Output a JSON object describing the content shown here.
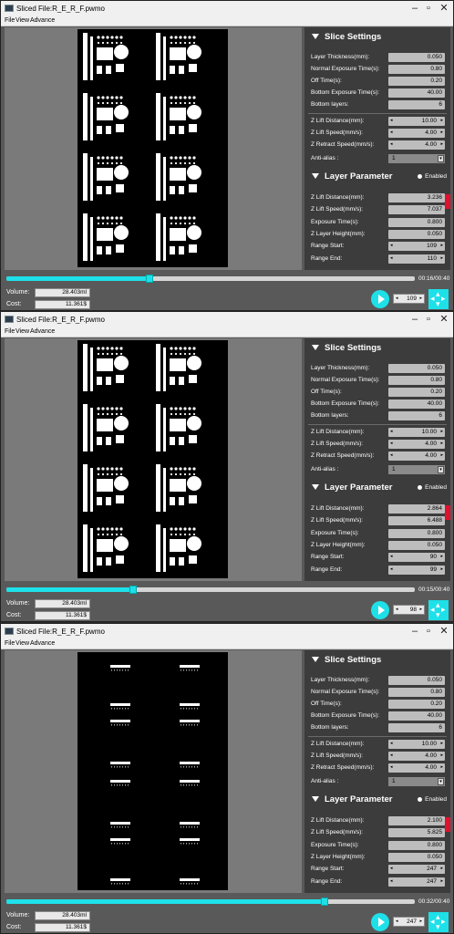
{
  "windows": [
    {
      "title": "Sliced File:R_E_R_F.pwmo",
      "menu": [
        "File",
        "View",
        "Advance"
      ],
      "slice_settings": {
        "header": "Slice Settings",
        "layer_thickness": {
          "label": "Layer Thickness(mm):",
          "value": "0.050"
        },
        "normal_exposure": {
          "label": "Normal Exposure Time(s):",
          "value": "0.80"
        },
        "off_time": {
          "label": "Off Time(s):",
          "value": "0.20"
        },
        "bottom_exposure": {
          "label": "Bottom Exposure Time(s):",
          "value": "40.00"
        },
        "bottom_layers": {
          "label": "Bottom layers:",
          "value": "6"
        },
        "z_lift_distance": {
          "label": "Z Lift Distance(mm):",
          "value": "10.00"
        },
        "z_lift_speed": {
          "label": "Z Lift Speed(mm/s):",
          "value": "4.00"
        },
        "z_retract_speed": {
          "label": "Z Retract Speed(mm/s):",
          "value": "4.00"
        },
        "anti_alias": {
          "label": "Anti-alias :",
          "value": "1"
        }
      },
      "layer_parameter": {
        "header": "Layer Parameter",
        "enabled_label": "Enabled",
        "z_lift_distance": {
          "label": "Z Lift Distance(mm):",
          "value": "3.236"
        },
        "z_lift_speed": {
          "label": "Z Lift Speed(mm/s):",
          "value": "7.037"
        },
        "exposure_time": {
          "label": "Exposure Time(s):",
          "value": "0.800"
        },
        "z_layer_height": {
          "label": "Z Layer Height(mm):",
          "value": "0.050"
        },
        "range_start": {
          "label": "Range Start:",
          "value": "109"
        },
        "range_end": {
          "label": "Range End:",
          "value": "110"
        }
      },
      "progress": 0.35,
      "time": "00:16/00:40",
      "volume": {
        "label": "Volume:",
        "value": "28.403ml"
      },
      "cost": {
        "label": "Cost:",
        "value": "11.361$"
      },
      "layer": "109",
      "preview_mode": "full"
    },
    {
      "title": "Sliced File:R_E_R_F.pwmo",
      "menu": [
        "File",
        "View",
        "Advance"
      ],
      "slice_settings": {
        "header": "Slice Settings",
        "layer_thickness": {
          "label": "Layer Thickness(mm):",
          "value": "0.050"
        },
        "normal_exposure": {
          "label": "Normal Exposure Time(s):",
          "value": "0.80"
        },
        "off_time": {
          "label": "Off Time(s):",
          "value": "0.20"
        },
        "bottom_exposure": {
          "label": "Bottom Exposure Time(s):",
          "value": "40.00"
        },
        "bottom_layers": {
          "label": "Bottom layers:",
          "value": "6"
        },
        "z_lift_distance": {
          "label": "Z Lift Distance(mm):",
          "value": "10.00"
        },
        "z_lift_speed": {
          "label": "Z Lift Speed(mm/s):",
          "value": "4.00"
        },
        "z_retract_speed": {
          "label": "Z Retract Speed(mm/s):",
          "value": "4.00"
        },
        "anti_alias": {
          "label": "Anti-alias :",
          "value": "1"
        }
      },
      "layer_parameter": {
        "header": "Layer Parameter",
        "enabled_label": "Enabled",
        "z_lift_distance": {
          "label": "Z Lift Distance(mm):",
          "value": "2.864"
        },
        "z_lift_speed": {
          "label": "Z Lift Speed(mm/s):",
          "value": "6.488"
        },
        "exposure_time": {
          "label": "Exposure Time(s):",
          "value": "0.800"
        },
        "z_layer_height": {
          "label": "Z Layer Height(mm):",
          "value": "0.050"
        },
        "range_start": {
          "label": "Range Start:",
          "value": "90"
        },
        "range_end": {
          "label": "Range End:",
          "value": "99"
        }
      },
      "progress": 0.31,
      "time": "00:15/00:40",
      "volume": {
        "label": "Volume:",
        "value": "28.403ml"
      },
      "cost": {
        "label": "Cost:",
        "value": "11.361$"
      },
      "layer": "98",
      "preview_mode": "full"
    },
    {
      "title": "Sliced File:R_E_R_F.pwmo",
      "menu": [
        "File",
        "View",
        "Advance"
      ],
      "slice_settings": {
        "header": "Slice Settings",
        "layer_thickness": {
          "label": "Layer Thickness(mm):",
          "value": "0.050"
        },
        "normal_exposure": {
          "label": "Normal Exposure Time(s):",
          "value": "0.80"
        },
        "off_time": {
          "label": "Off Time(s):",
          "value": "0.20"
        },
        "bottom_exposure": {
          "label": "Bottom Exposure Time(s):",
          "value": "40.00"
        },
        "bottom_layers": {
          "label": "Bottom layers:",
          "value": "6"
        },
        "z_lift_distance": {
          "label": "Z Lift Distance(mm):",
          "value": "10.00"
        },
        "z_lift_speed": {
          "label": "Z Lift Speed(mm/s):",
          "value": "4.00"
        },
        "z_retract_speed": {
          "label": "Z Retract Speed(mm/s):",
          "value": "4.00"
        },
        "anti_alias": {
          "label": "Anti-alias :",
          "value": "1"
        }
      },
      "layer_parameter": {
        "header": "Layer Parameter",
        "enabled_label": "Enabled",
        "z_lift_distance": {
          "label": "Z Lift Distance(mm):",
          "value": "2.100"
        },
        "z_lift_speed": {
          "label": "Z Lift Speed(mm/s):",
          "value": "5.825"
        },
        "exposure_time": {
          "label": "Exposure Time(s):",
          "value": "0.800"
        },
        "z_layer_height": {
          "label": "Z Layer Height(mm):",
          "value": "0.050"
        },
        "range_start": {
          "label": "Range Start:",
          "value": "247"
        },
        "range_end": {
          "label": "Range End:",
          "value": "247"
        }
      },
      "progress": 0.78,
      "time": "00:32/00:40",
      "volume": {
        "label": "Volume:",
        "value": "28.403ml"
      },
      "cost": {
        "label": "Cost:",
        "value": "11.361$"
      },
      "layer": "247",
      "preview_mode": "sparse"
    }
  ],
  "colors": {
    "accent": "#1ee0e8",
    "alert": "#e0102e",
    "panel": "#3c3c3c",
    "viewport": "#7a7a7a"
  }
}
